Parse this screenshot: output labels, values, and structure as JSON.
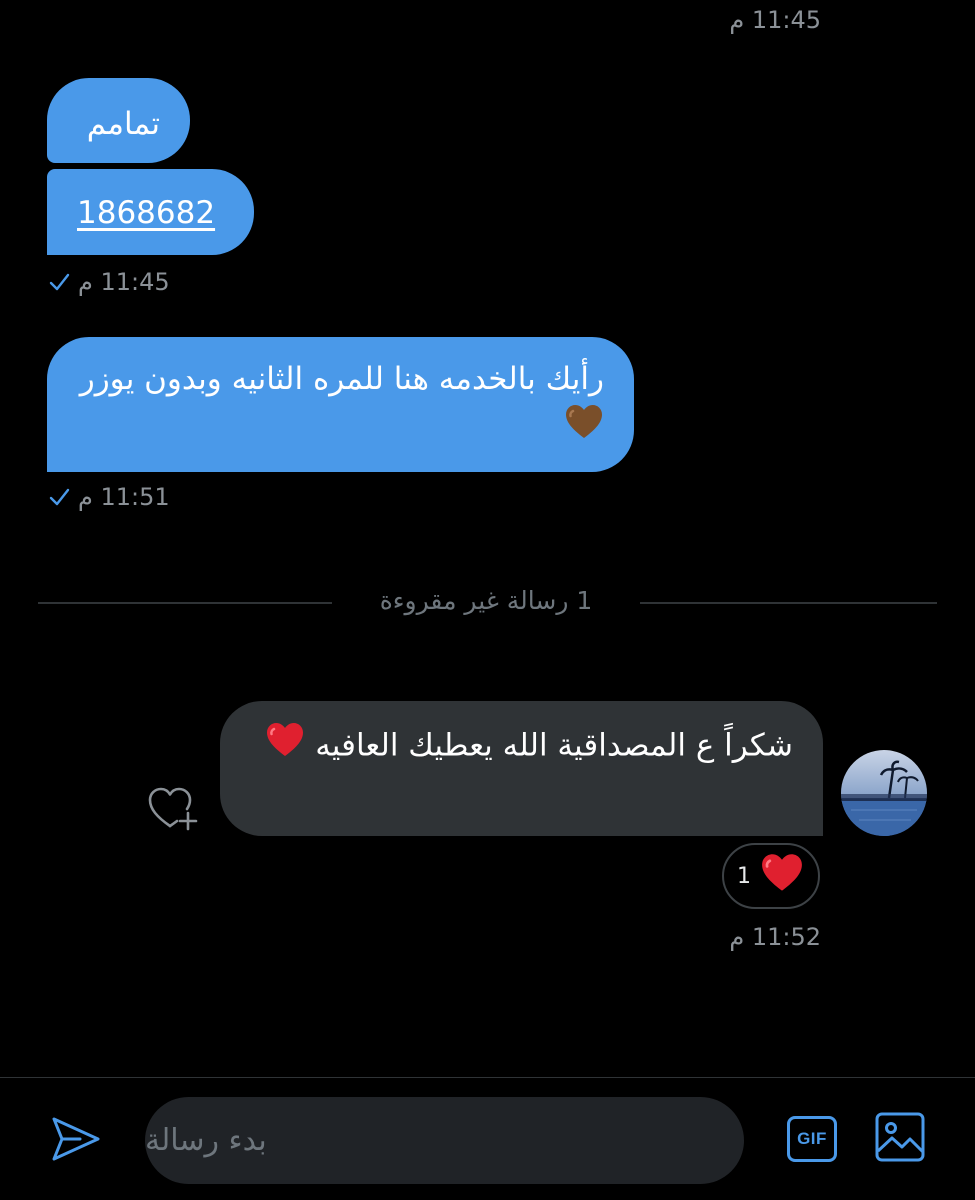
{
  "colors": {
    "accent": "#4a99e9",
    "background": "#000000",
    "received_bubble": "#2f3336",
    "timestamp": "#8b9197",
    "heart": "#e0202f",
    "brown_heart": "#7a4f2a"
  },
  "messages": [
    {
      "type": "timestamp",
      "text": "11:45 م"
    },
    {
      "type": "sent",
      "text": "تمامم"
    },
    {
      "type": "sent",
      "text": "1868682",
      "is_link": true
    },
    {
      "type": "timestamp",
      "text": "11:45 م",
      "read": true
    },
    {
      "type": "sent",
      "text": "رأيك بالخدمه هنا للمره الثانيه وبدون يوزر",
      "emoji": "brown-heart"
    },
    {
      "type": "timestamp",
      "text": "11:51 م",
      "read": true
    },
    {
      "type": "received",
      "text": "شكراً ع المصداقية الله يعطيك العافيه",
      "emoji": "red-heart"
    },
    {
      "type": "timestamp",
      "text": "11:52 م"
    }
  ],
  "unread_divider": "1 رسالة غير مقروءة",
  "reaction": {
    "emoji": "red-heart",
    "count": "1"
  },
  "compose": {
    "placeholder": "بدء رسالة"
  },
  "icons": {
    "react": "heart-plus-icon",
    "send": "send-icon",
    "gif": "gif-icon",
    "image": "image-icon"
  },
  "gif_label": "GIF"
}
